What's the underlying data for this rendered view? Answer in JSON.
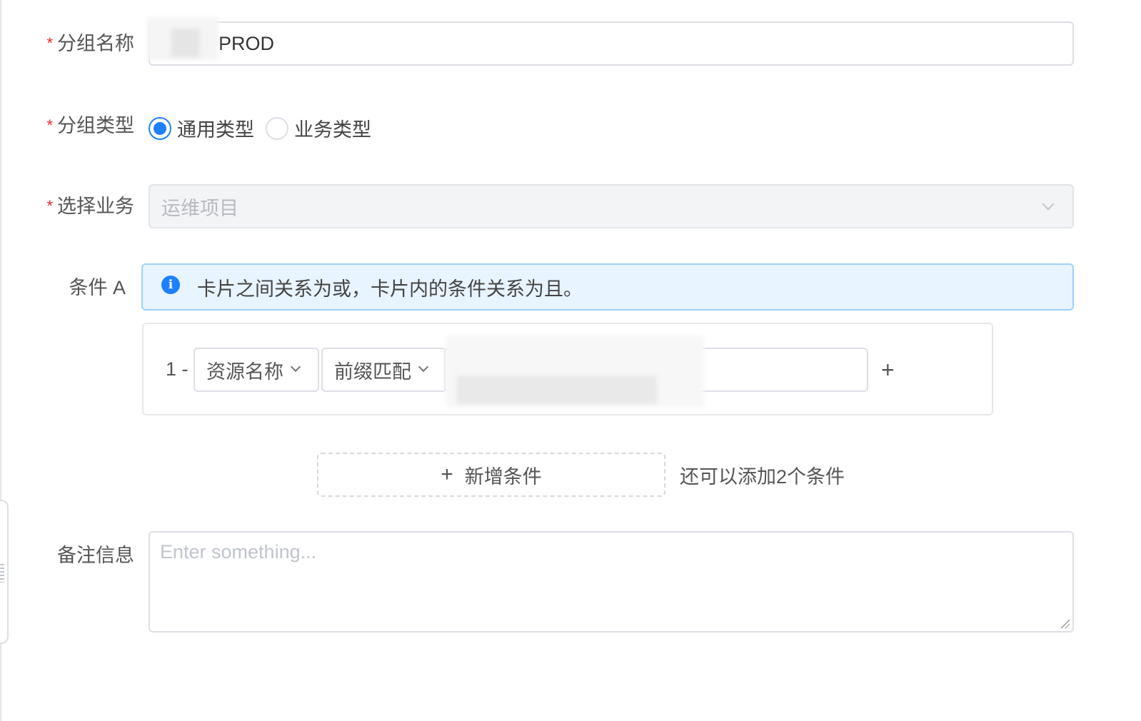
{
  "form": {
    "group_name": {
      "label": "分组名称",
      "value": "PROD"
    },
    "group_type": {
      "label": "分组类型",
      "options": [
        {
          "label": "通用类型",
          "checked": true
        },
        {
          "label": "业务类型",
          "checked": false
        }
      ]
    },
    "business": {
      "label": "选择业务",
      "placeholder": "运维项目"
    },
    "condition": {
      "label": "条件 A",
      "info": "卡片之间关系为或，卡片内的条件关系为且。",
      "rows": [
        {
          "index": "1 -",
          "field": "资源名称",
          "operator": "前缀匹配"
        }
      ],
      "add_label": "新增条件",
      "hint": "还可以添加2个条件"
    },
    "remark": {
      "label": "备注信息",
      "placeholder": "Enter something..."
    }
  },
  "icons": {
    "required": "*",
    "info": "i",
    "plus": "+"
  },
  "colors": {
    "primary": "#1e80ff",
    "required": "#f5222d",
    "info_bg": "#e8f4ff"
  }
}
